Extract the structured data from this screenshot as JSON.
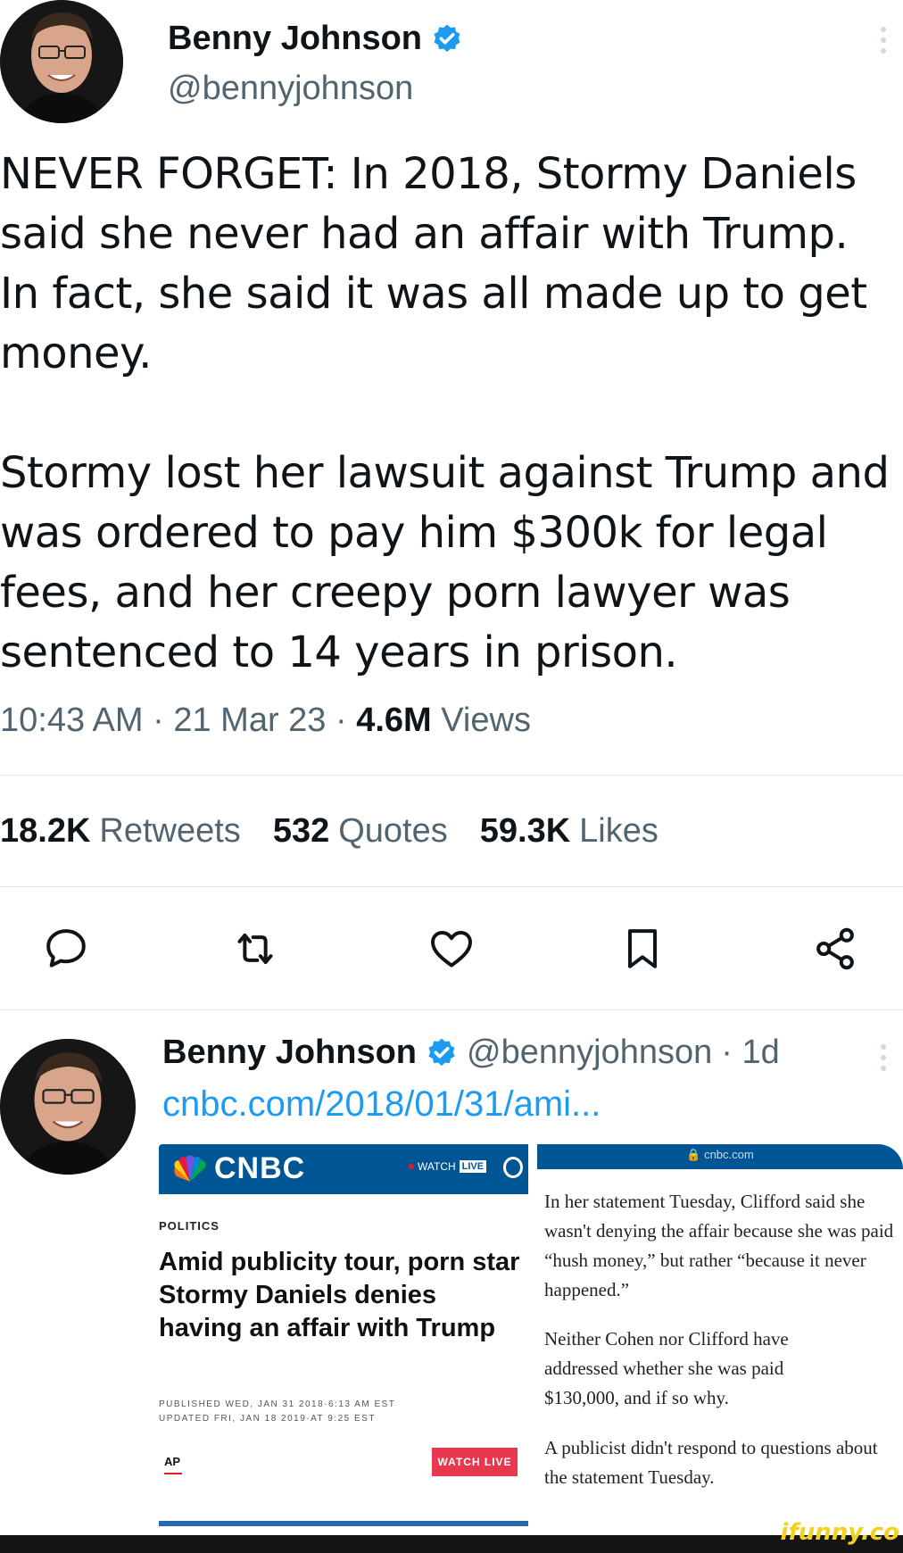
{
  "tweet": {
    "author_name": "Benny Johnson",
    "author_handle": "@bennyjohnson",
    "text": "NEVER FORGET: In 2018, Stormy Daniels said she never had an affair with Trump. In fact, she said it was all made up to get money.\n\nStormy lost her lawsuit against Trump and was ordered to pay him $300k for legal fees, and her creepy porn lawyer was sentenced to 14 years in prison.",
    "time": "10:43 AM",
    "date": "21 Mar 23",
    "separator": "·",
    "views_count": "4.6M",
    "views_label": "Views",
    "stats": {
      "retweets_count": "18.2K",
      "retweets_label": "Retweets",
      "quotes_count": "532",
      "quotes_label": "Quotes",
      "likes_count": "59.3K",
      "likes_label": "Likes"
    },
    "actions": [
      "reply-icon",
      "retweet-icon",
      "like-icon",
      "bookmark-icon",
      "share-icon"
    ]
  },
  "reply": {
    "author_name": "Benny Johnson",
    "author_handle": "@bennyjohnson",
    "age": "· 1d",
    "link": "cnbc.com/2018/01/31/ami...",
    "card_left": {
      "brand": "CNBC",
      "watch_label": "WATCH",
      "live_label": "LIVE",
      "section": "POLITICS",
      "headline": "Amid publicity tour, porn star Stormy Daniels denies having an affair with Trump",
      "published": "PUBLISHED WED, JAN 31 2018·6:13 AM EST\nUPDATED FRI, JAN 18 2019·AT 9:25 EST",
      "source": "AP",
      "watch_live_button": "WATCH LIVE"
    },
    "card_right": {
      "url": "🔒 cnbc.com",
      "paragraph_1": "In her statement Tuesday, Clifford said she wasn't denying the affair because she was paid “hush money,” but rather “because it never happened.”",
      "paragraph_2": "Neither Cohen nor Clifford have addressed whether she was paid $130,000, and if so why.",
      "paragraph_3": "A publicist didn't respond to questions about the statement Tuesday."
    }
  },
  "watermark": "ifunny.co",
  "colors": {
    "text": "#0f1419",
    "muted": "#536471",
    "link": "#1d9bf0",
    "verified": "#1d9bf0",
    "cnbc_blue": "#005594"
  }
}
